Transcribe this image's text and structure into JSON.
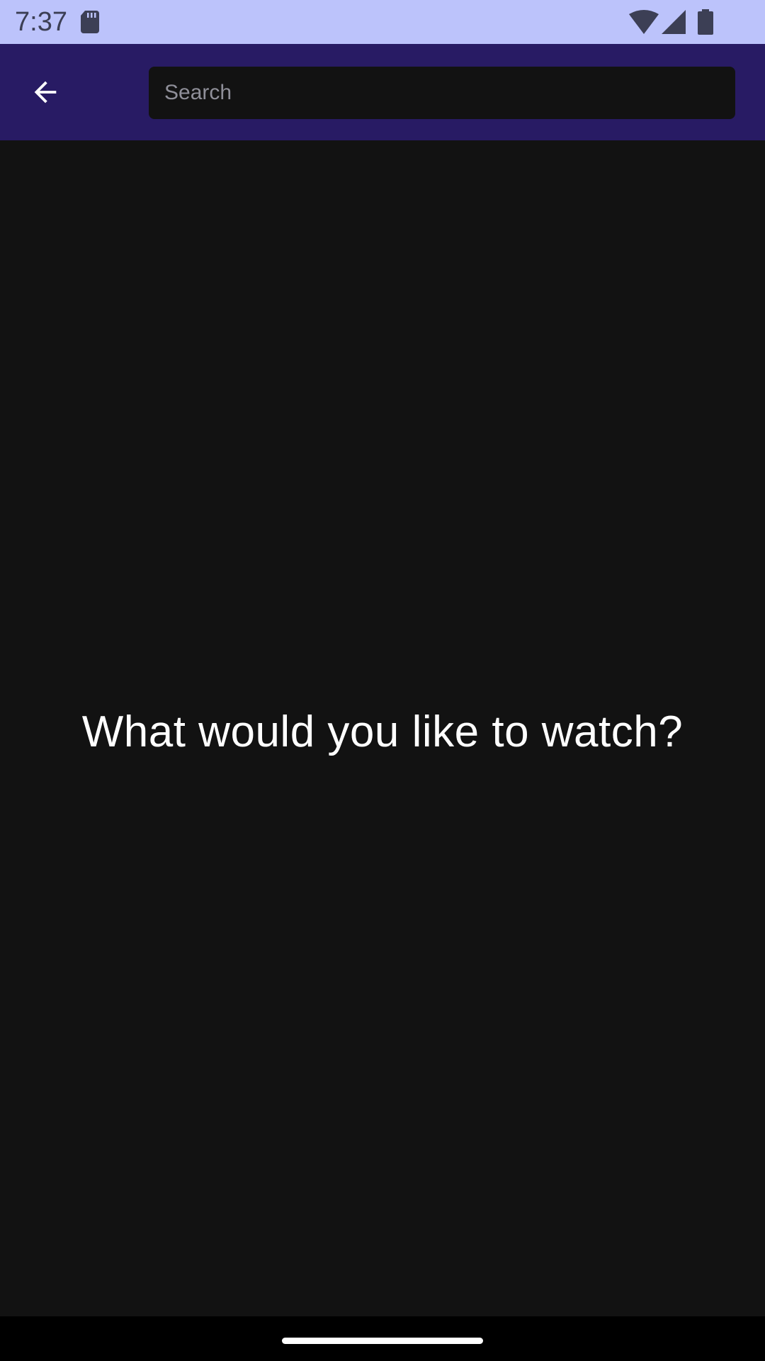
{
  "status_bar": {
    "time": "7:37",
    "icons": [
      "sd-card-icon",
      "wifi-icon",
      "cell-signal-icon",
      "battery-icon"
    ],
    "background_color": "#bcc3fb"
  },
  "app_bar": {
    "back_icon": "arrow-back-icon",
    "search": {
      "placeholder": "Search",
      "value": ""
    },
    "background_color": "#281b64"
  },
  "main": {
    "prompt": "What would you like to watch?",
    "background_color": "#121212"
  },
  "nav_bar": {
    "background_color": "#000000"
  }
}
